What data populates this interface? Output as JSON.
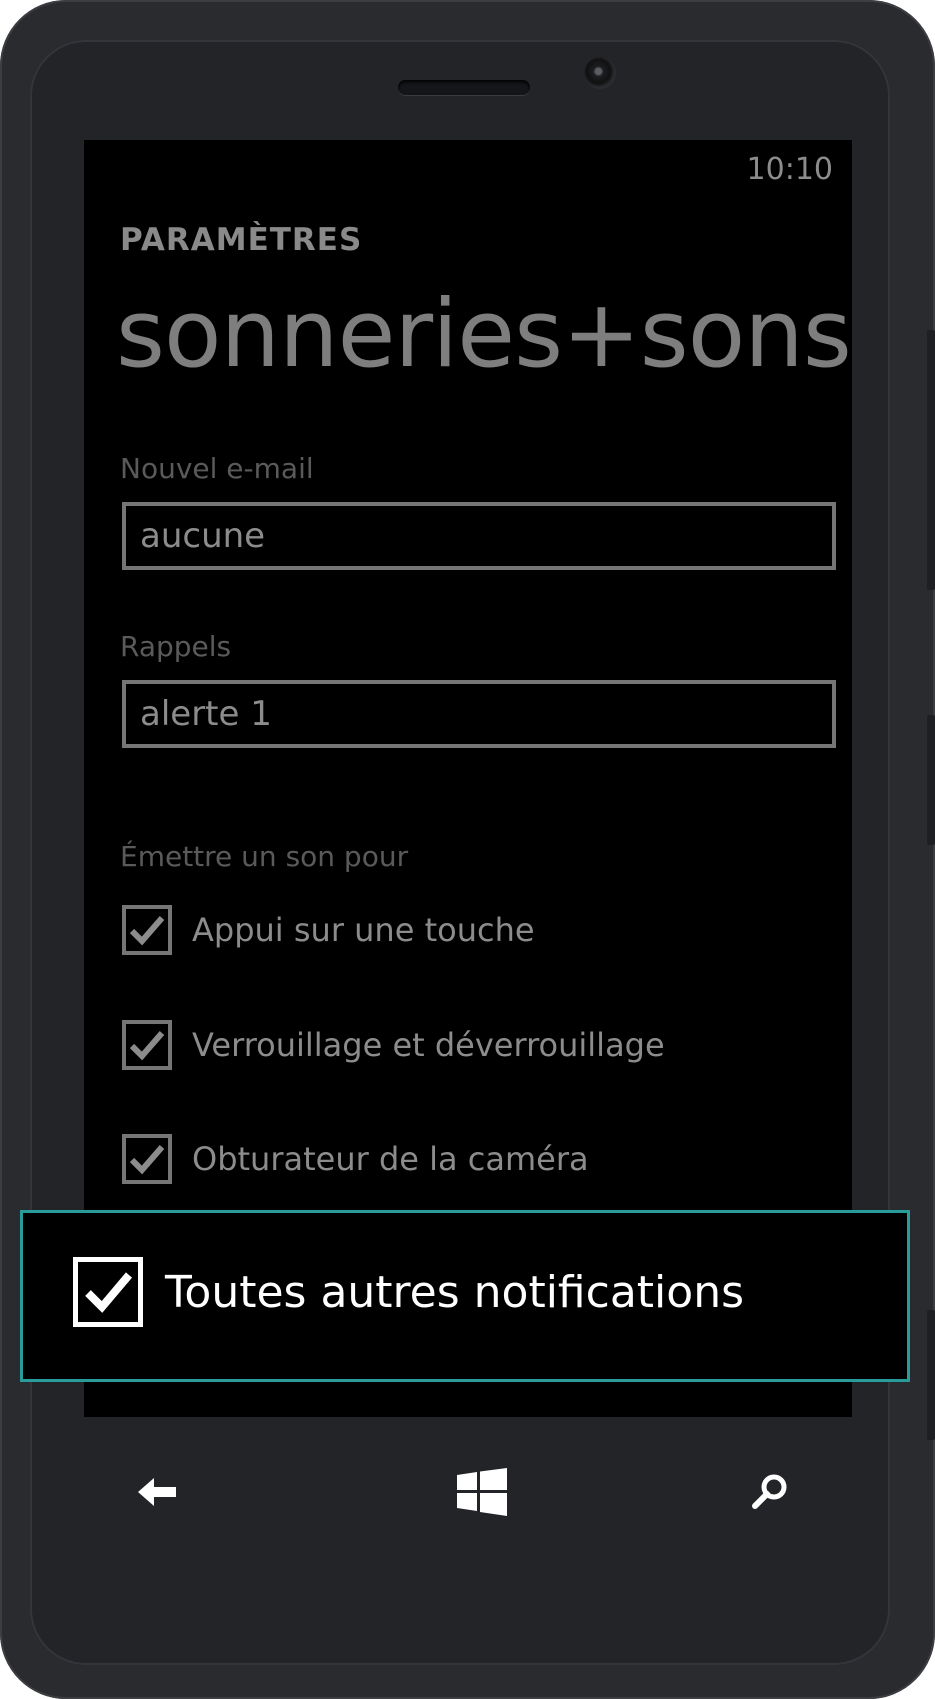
{
  "status_bar": {
    "time": "10:10"
  },
  "header": {
    "section": "PARAMÈTRES",
    "title": "sonneries+sons"
  },
  "fields": [
    {
      "label": "Nouvel e-mail",
      "value": "aucune"
    },
    {
      "label": "Rappels",
      "value": "alerte 1"
    }
  ],
  "sounds_section": {
    "label": "Émettre un son pour",
    "options": [
      {
        "label": "Appui sur une touche",
        "checked": true
      },
      {
        "label": "Verrouillage et déverrouillage",
        "checked": true
      },
      {
        "label": "Obturateur de la caméra",
        "checked": true
      }
    ]
  },
  "highlighted_option": {
    "label": "Toutes autres notifications",
    "checked": true
  },
  "nav_bar": {
    "back_icon": "back-arrow-icon",
    "start_icon": "windows-logo-icon",
    "search_icon": "search-icon"
  },
  "colors": {
    "highlight_border": "#2a9b9b",
    "phone_body": "#2a2b2e",
    "screen_bg": "#000000"
  }
}
